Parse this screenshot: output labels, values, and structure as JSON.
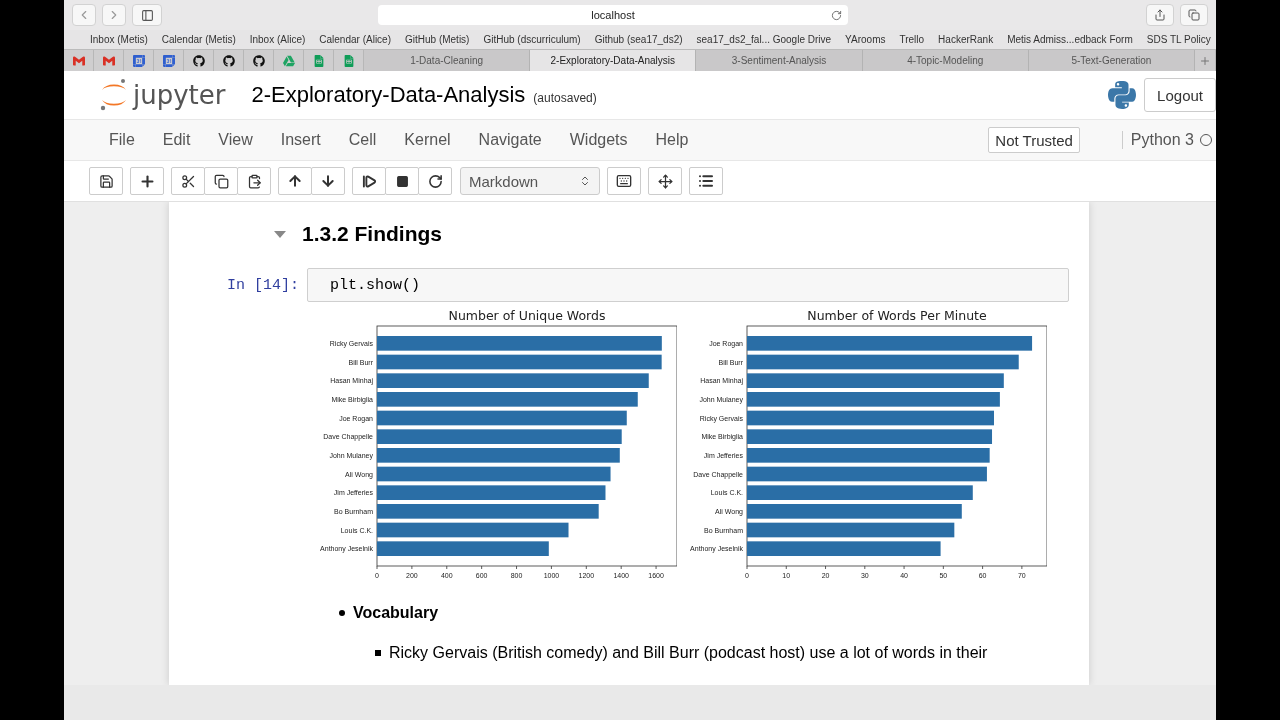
{
  "browser": {
    "address": "localhost",
    "bookmarks": [
      "Inbox (Metis)",
      "Calendar (Metis)",
      "Inbox (Alice)",
      "Calendar (Alice)",
      "GitHub (Metis)",
      "GitHub (dscurriculum)",
      "Github (sea17_ds2)",
      "sea17_ds2_fal... Google Drive",
      "YArooms",
      "Trello",
      "HackerRank",
      "Metis Admiss...edback Form",
      "SDS TL Policy"
    ],
    "pinned_tabs": [
      {
        "kind": "mail"
      },
      {
        "kind": "mail"
      },
      {
        "kind": "calendar"
      },
      {
        "kind": "calendar"
      },
      {
        "kind": "github"
      },
      {
        "kind": "github"
      },
      {
        "kind": "github"
      },
      {
        "kind": "drive"
      },
      {
        "kind": "sheet"
      },
      {
        "kind": "sheet"
      }
    ],
    "tabs": [
      {
        "label": "1-Data-Cleaning",
        "selected": false
      },
      {
        "label": "2-Exploratory-Data-Analysis",
        "selected": true
      },
      {
        "label": "3-Sentiment-Analysis",
        "selected": false
      },
      {
        "label": "4-Topic-Modeling",
        "selected": false
      },
      {
        "label": "5-Text-Generation",
        "selected": false
      }
    ]
  },
  "header": {
    "logo": "jupyter",
    "notebook_title": "2-Exploratory-Data-Analysis",
    "save_status": "(autosaved)",
    "logout": "Logout"
  },
  "menu": [
    "File",
    "Edit",
    "View",
    "Insert",
    "Cell",
    "Kernel",
    "Navigate",
    "Widgets",
    "Help"
  ],
  "trust": "Not Trusted",
  "kernel": "Python 3",
  "toolbar": {
    "cell_type": "Markdown"
  },
  "notebook": {
    "heading": "1.3.2  Findings",
    "prompt": "In [14]:",
    "code": "plt.show()",
    "charts": [
      {
        "chart_data": {
          "type": "bar",
          "orientation": "horizontal",
          "title": "Number of Unique Words",
          "categories": [
            "Ricky Gervais",
            "Bill Burr",
            "Hasan Minhaj",
            "Mike Birbiglia",
            "Joe Rogan",
            "Dave Chappelle",
            "John Mulaney",
            "Ali Wong",
            "Jim Jefferies",
            "Bo Burnham",
            "Louis C.K.",
            "Anthony Jeselnik"
          ],
          "series": [
            {
              "color": "#2a6ea6",
              "values": [
                1633,
                1632,
                1558,
                1495,
                1432,
                1403,
                1392,
                1339,
                1310,
                1271,
                1098,
                985
              ]
            }
          ],
          "xlim": [
            0,
            1720
          ],
          "xticks": [
            0,
            200,
            400,
            600,
            800,
            1000,
            1200,
            1400,
            1600
          ]
        }
      },
      {
        "chart_data": {
          "type": "bar",
          "orientation": "horizontal",
          "title": "Number of Words Per Minute",
          "categories": [
            "Joe Rogan",
            "Bill Burr",
            "Hasan Minhaj",
            "John Mulaney",
            "Ricky Gervais",
            "Mike Birbiglia",
            "Jim Jefferies",
            "Dave Chappelle",
            "Louis C.K.",
            "Ali Wong",
            "Bo Burnham",
            "Anthony Jeselnik"
          ],
          "series": [
            {
              "color": "#2a6ea6",
              "values": [
                72.6,
                69.2,
                65.4,
                64.4,
                62.9,
                62.4,
                61.8,
                61.1,
                57.5,
                54.7,
                52.8,
                49.3
              ]
            }
          ],
          "xlim": [
            0,
            76.4
          ],
          "xticks": [
            0,
            10,
            20,
            30,
            40,
            50,
            60,
            70
          ]
        }
      }
    ],
    "bullets": [
      {
        "text": "Vocabulary",
        "children": [
          {
            "text": "Ricky Gervais (British comedy) and Bill Burr (podcast host) use a lot of words in their"
          }
        ]
      }
    ]
  }
}
